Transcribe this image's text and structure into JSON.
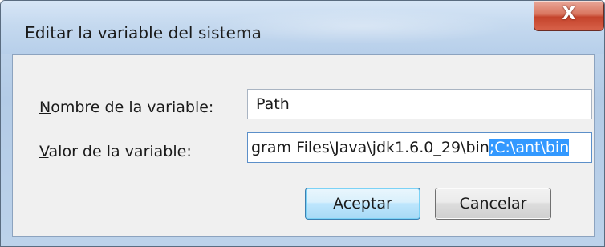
{
  "window": {
    "title": "Editar la variable del sistema",
    "close_glyph": "X"
  },
  "form": {
    "name_label_mnemonic": "N",
    "name_label_rest": "ombre de la variable:",
    "name_value": "Path",
    "value_label_mnemonic": "V",
    "value_label_rest": "alor de la variable:",
    "value_unselected": "gram Files\\Java\\jdk1.6.0_29\\bin",
    "value_selected": ";C:\\ant\\bin"
  },
  "buttons": {
    "ok_label": "Aceptar",
    "cancel_label": "Cancelar"
  },
  "colors": {
    "selection": "#3399ff",
    "close_button": "#c4432b"
  }
}
